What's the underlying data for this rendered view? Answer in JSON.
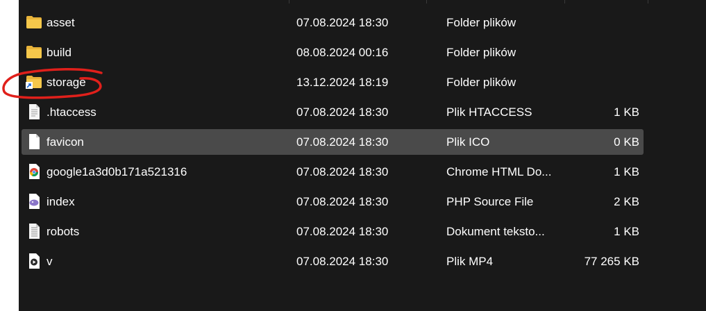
{
  "colors": {
    "background": "#191919",
    "selected_row": "#4a4a4a",
    "text": "#ffffff",
    "folder": "#f6c84b",
    "annotation": "#e0201b"
  },
  "files": [
    {
      "name": "asset",
      "date": "07.08.2024 18:30",
      "type": "Folder plików",
      "size": "",
      "icon": "folder-icon"
    },
    {
      "name": "build",
      "date": "08.08.2024 00:16",
      "type": "Folder plików",
      "size": "",
      "icon": "folder-icon"
    },
    {
      "name": "storage",
      "date": "13.12.2024 18:19",
      "type": "Folder plików",
      "size": "",
      "icon": "folder-shortcut-icon"
    },
    {
      "name": ".htaccess",
      "date": "07.08.2024 18:30",
      "type": "Plik HTACCESS",
      "size": "1 KB",
      "icon": "text-file-icon"
    },
    {
      "name": "favicon",
      "date": "07.08.2024 18:30",
      "type": "Plik ICO",
      "size": "0 KB",
      "icon": "blank-file-icon",
      "selected": true
    },
    {
      "name": "google1a3d0b171a521316",
      "date": "07.08.2024 18:30",
      "type": "Chrome HTML Do...",
      "size": "1 KB",
      "icon": "chrome-icon"
    },
    {
      "name": "index",
      "date": "07.08.2024 18:30",
      "type": "PHP Source File",
      "size": "2 KB",
      "icon": "php-icon"
    },
    {
      "name": "robots",
      "date": "07.08.2024 18:30",
      "type": "Dokument teksto...",
      "size": "1 KB",
      "icon": "text-document-icon"
    },
    {
      "name": "v",
      "date": "07.08.2024 18:30",
      "type": "Plik MP4",
      "size": "77 265 KB",
      "icon": "video-file-icon"
    }
  ]
}
